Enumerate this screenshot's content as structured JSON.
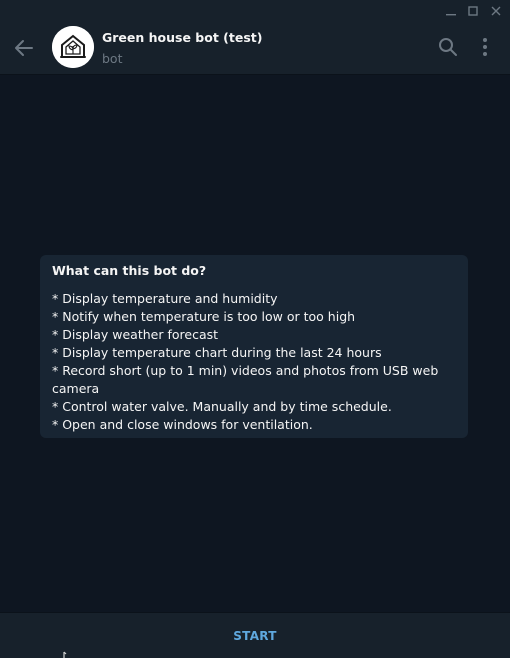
{
  "window_controls": {
    "minimize_icon": "minimize-icon",
    "maximize_icon": "maximize-icon",
    "close_icon": "close-icon"
  },
  "header": {
    "title": "Green house bot (test)",
    "subtitle": "bot",
    "back_icon": "back-arrow-icon",
    "search_icon": "search-icon",
    "menu_icon": "more-vertical-icon",
    "avatar_icon": "greenhouse-icon"
  },
  "intro": {
    "title": "What can this bot do?",
    "lines": [
      "* Display temperature and humidity",
      "* Notify when temperature is too low or too high",
      "* Display weather forecast",
      "* Display temperature chart during the last 24 hours",
      "* Record short (up to 1 min) videos and photos from USB web",
      "camera",
      "* Control water valve. Manually and by time schedule.",
      "* Open and close windows for ventilation."
    ]
  },
  "bottom": {
    "start_label": "START"
  },
  "colors": {
    "background": "#0e1621",
    "panel": "#17212b",
    "card": "#182533",
    "accent": "#5fa8de",
    "muted": "#6d7883",
    "text": "#f5f5f5"
  }
}
